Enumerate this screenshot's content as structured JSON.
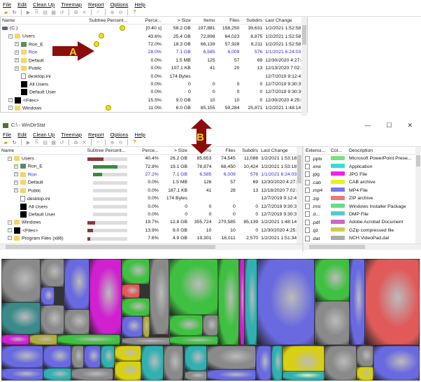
{
  "menu": [
    "File",
    "Edit",
    "Clean Up",
    "Treemap",
    "Report",
    "Options",
    "Help"
  ],
  "top_window": {
    "columns": [
      "Name",
      "Subtree Percent...",
      "Perce...",
      "> Size",
      "Items",
      "Files",
      "Subdirs",
      "Last Change"
    ],
    "rows": [
      {
        "name": "(C:)",
        "pct": "[0:40 s]",
        "size": "58.2 GB",
        "items": "197,881",
        "files": "158,250",
        "subdirs": "39,631",
        "last": "1/2/2021 1:52:58 A...",
        "icon": "drive-icon",
        "level": 0
      },
      {
        "name": "Users",
        "pct": "43.6%",
        "size": "25.4 GB",
        "items": "72,898",
        "files": "64,023",
        "subdirs": "8,875",
        "last": "1/2/2021 1:52:58 A...",
        "icon": "folder-icon",
        "level": 1
      },
      {
        "name": "Ron_E",
        "pct": "72.0%",
        "size": "18.3 GB",
        "items": "66,139",
        "files": "57,928",
        "subdirs": "8,211",
        "last": "1/2/2021 1:52:58 A...",
        "icon": "user-folder-icon",
        "level": 2
      },
      {
        "name": "Ron",
        "pct": "28.0%",
        "size": "7.1 GB",
        "items": "6,585",
        "files": "6,009",
        "subdirs": "576",
        "last": "1/1/2021 6:24:03 P...",
        "icon": "folder-icon",
        "level": 2,
        "highlight": true
      },
      {
        "name": "Default",
        "pct": "0.0%",
        "size": "1.5 MB",
        "items": "125",
        "files": "57",
        "subdirs": "69",
        "last": "12/30/2020 4:27:4...",
        "icon": "folder-icon",
        "level": 2
      },
      {
        "name": "Public",
        "pct": "0.0%",
        "size": "107.1 KB",
        "items": "41",
        "files": "20",
        "subdirs": "13",
        "last": "12/13/2020 7:02:2...",
        "icon": "folder-icon",
        "level": 2
      },
      {
        "name": "desktop.ini",
        "pct": "0.0%",
        "size": "174 Bytes",
        "items": "",
        "files": "",
        "subdirs": "",
        "last": "12/7/2019 9:12:42 ...",
        "icon": "file-icon",
        "level": 2
      },
      {
        "name": "All Users",
        "pct": "0.0%",
        "size": "0",
        "items": "0",
        "files": "0",
        "subdirs": "0",
        "last": "12/7/2019 9:30:39 ...",
        "icon": "link-icon",
        "level": 2
      },
      {
        "name": "Default User",
        "pct": "0.0%",
        "size": "0",
        "items": "0",
        "files": "0",
        "subdirs": "0",
        "last": "12/7/2019 9:30:39 ...",
        "icon": "link-icon",
        "level": 2
      },
      {
        "name": "<Files>",
        "pct": "15.5%",
        "size": "9.0 GB",
        "items": "10",
        "files": "10",
        "subdirs": "0",
        "last": "12/30/2020 4:25:0...",
        "icon": "files-icon",
        "level": 1
      },
      {
        "name": "Windows",
        "pct": "11.0%",
        "size": "6.0 GB",
        "items": "85,155",
        "files": "59,284",
        "subdirs": "25,871",
        "last": "1/2/2021 1:48:14 A...",
        "icon": "folder-icon",
        "level": 1
      }
    ]
  },
  "callouts": {
    "a": "A",
    "b": "B"
  },
  "bottom_window": {
    "title": "C:\\ - WinDirStat",
    "controls": {
      "minimize": "—",
      "maximize": "☐",
      "close": "✕"
    },
    "columns": [
      "Name",
      "Subtree Percent...",
      "Perce...",
      "> Size",
      "Items",
      "Files",
      "Subdirs",
      "Last Change"
    ],
    "rows": [
      {
        "name": "Users",
        "bar": 0.404,
        "barcolor": "#8b3a3a",
        "pct": "40.4%",
        "size": "26.2 GB",
        "items": "85,653",
        "files": "74,545",
        "subdirs": "11,088",
        "last": "1/2/2021 1:53:18",
        "icon": "folder-icon",
        "level": 1
      },
      {
        "name": "Ron_E",
        "bar": 0.728,
        "barcolor": "#3a8b3a",
        "pct": "72.8%",
        "size": "19.1 GB",
        "items": "78,874",
        "files": "68,450",
        "subdirs": "10,424",
        "last": "1/2/2021 1:53:18",
        "icon": "user-folder-icon",
        "level": 2
      },
      {
        "name": "Ron",
        "bar": 0.272,
        "barcolor": "#3a8b3a",
        "pct": "27.2%",
        "size": "7.1 GB",
        "items": "6,585",
        "files": "6,009",
        "subdirs": "576",
        "last": "1/1/2021 6:24:03",
        "icon": "folder-icon",
        "level": 2,
        "highlight": true
      },
      {
        "name": "Default",
        "bar": 0,
        "barcolor": "#3a8b3a",
        "pct": "0.0%",
        "size": "1.5 MB",
        "items": "126",
        "files": "57",
        "subdirs": "69",
        "last": "12/30/2020 4:27:",
        "icon": "folder-icon",
        "level": 2
      },
      {
        "name": "Public",
        "bar": 0,
        "barcolor": "#3a8b3a",
        "pct": "0.0%",
        "size": "187.1 KB",
        "items": "41",
        "files": "28",
        "subdirs": "13",
        "last": "12/18/2020 7:02:",
        "icon": "folder-icon",
        "level": 2
      },
      {
        "name": "desktop.ini",
        "bar": 0,
        "barcolor": "#3a8b3a",
        "pct": "0.0%",
        "size": "174 Bytes",
        "items": "",
        "files": "",
        "subdirs": "",
        "last": "12/7/2019 9:12:4",
        "icon": "file-icon",
        "level": 2
      },
      {
        "name": "All Users",
        "bar": 0,
        "barcolor": "#3a8b3a",
        "pct": "0.0%",
        "size": "0",
        "items": "0",
        "files": "0",
        "subdirs": "0",
        "last": "12/7/2019 9:30:3",
        "icon": "link-icon",
        "level": 2
      },
      {
        "name": "Default User",
        "bar": 0,
        "barcolor": "#3a8b3a",
        "pct": "0.0%",
        "size": "0",
        "items": "0",
        "files": "0",
        "subdirs": "0",
        "last": "12/7/2019 9:30:3",
        "icon": "link-icon",
        "level": 2
      },
      {
        "name": "Windows",
        "bar": 0.197,
        "barcolor": "#8b3a3a",
        "pct": "19.7%",
        "size": "12.8 GB",
        "items": "355,724",
        "files": "270,585",
        "subdirs": "85,139",
        "last": "1/2/2021 1:48:14",
        "icon": "folder-icon",
        "level": 1
      },
      {
        "name": "<Files>",
        "bar": 0.139,
        "barcolor": "#8b3a3a",
        "pct": "13.9%",
        "size": "9.0 GB",
        "items": "10",
        "files": "10",
        "subdirs": "0",
        "last": "12/30/2020 4:25:",
        "icon": "files-icon",
        "level": 1
      },
      {
        "name": "Program Files (x86)",
        "bar": 0.076,
        "barcolor": "#8b3a3a",
        "pct": "7.6%",
        "size": "4.9 GB",
        "items": "19,301",
        "files": "16,011",
        "subdirs": "2,570",
        "last": "1/2/2021 1:51:34",
        "icon": "folder-icon",
        "level": 1
      }
    ],
    "ext_columns": [
      "Extensi...",
      "Col...",
      "Description"
    ],
    "extensions": [
      {
        "ext": ".pptx",
        "color": "#7ee07e",
        "desc": "Microsoft PowerPoint Prese..."
      },
      {
        "ext": ".exe",
        "color": "#33dddd",
        "desc": "Application"
      },
      {
        "ext": ".jpg",
        "color": "#ee22ee",
        "desc": "JPG File"
      },
      {
        "ext": ".cab",
        "color": "#eeee22",
        "desc": "CAB archive"
      },
      {
        "ext": ".mp4",
        "color": "#7777ee",
        "desc": "MP4 File"
      },
      {
        "ext": ".zip",
        "color": "#ee7777",
        "desc": "ZIP archive"
      },
      {
        "ext": ".msi",
        "color": "#66dd88",
        "desc": "Windows Installer Package"
      },
      {
        "ext": ".d...",
        "color": "#55cccc",
        "desc": "DMP File"
      },
      {
        "ext": ".pdf",
        "color": "#cc66cc",
        "desc": "Adobe Acrobat Document"
      },
      {
        "ext": ".gz",
        "color": "#cccc55",
        "desc": "GZip compressed file"
      },
      {
        "ext": ".dat",
        "color": "#aaaaaa",
        "desc": "NCH.VideoPad.dat"
      }
    ]
  }
}
